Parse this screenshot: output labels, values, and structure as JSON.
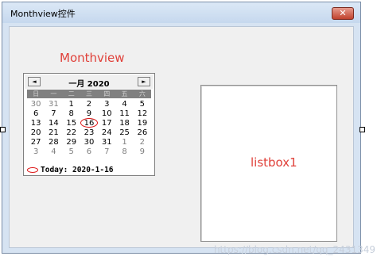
{
  "window": {
    "title": "Monthview控件",
    "close_glyph": "✕"
  },
  "labels": {
    "monthview_caption": "Monthview",
    "listbox_caption": "listbox1"
  },
  "calendar": {
    "prev_glyph": "◄",
    "next_glyph": "►",
    "month_year": "一月 2020",
    "weekdays": [
      "星期日",
      "星期一",
      "星期二",
      "星期三",
      "星期四",
      "星期五",
      "星期六"
    ],
    "days": [
      {
        "d": "30",
        "other": true
      },
      {
        "d": "31",
        "other": true
      },
      {
        "d": "1"
      },
      {
        "d": "2"
      },
      {
        "d": "3"
      },
      {
        "d": "4"
      },
      {
        "d": "5"
      },
      {
        "d": "6"
      },
      {
        "d": "7"
      },
      {
        "d": "8"
      },
      {
        "d": "9"
      },
      {
        "d": "10"
      },
      {
        "d": "11"
      },
      {
        "d": "12"
      },
      {
        "d": "13"
      },
      {
        "d": "14"
      },
      {
        "d": "15"
      },
      {
        "d": "16",
        "today": true
      },
      {
        "d": "17"
      },
      {
        "d": "18"
      },
      {
        "d": "19"
      },
      {
        "d": "20"
      },
      {
        "d": "21"
      },
      {
        "d": "22"
      },
      {
        "d": "23"
      },
      {
        "d": "24"
      },
      {
        "d": "25"
      },
      {
        "d": "26"
      },
      {
        "d": "27"
      },
      {
        "d": "28"
      },
      {
        "d": "29"
      },
      {
        "d": "30"
      },
      {
        "d": "31"
      },
      {
        "d": "1",
        "other": true
      },
      {
        "d": "2",
        "other": true
      },
      {
        "d": "3",
        "other": true
      },
      {
        "d": "4",
        "other": true
      },
      {
        "d": "5",
        "other": true
      },
      {
        "d": "6",
        "other": true
      },
      {
        "d": "7",
        "other": true
      },
      {
        "d": "8",
        "other": true
      },
      {
        "d": "9",
        "other": true
      }
    ],
    "today_text": "Today: 2020-1-16"
  },
  "watermark": "https://blog.csdn.net/qq_2431349",
  "colors": {
    "caption": "#e0413a",
    "today_circle": "#dd1111"
  }
}
